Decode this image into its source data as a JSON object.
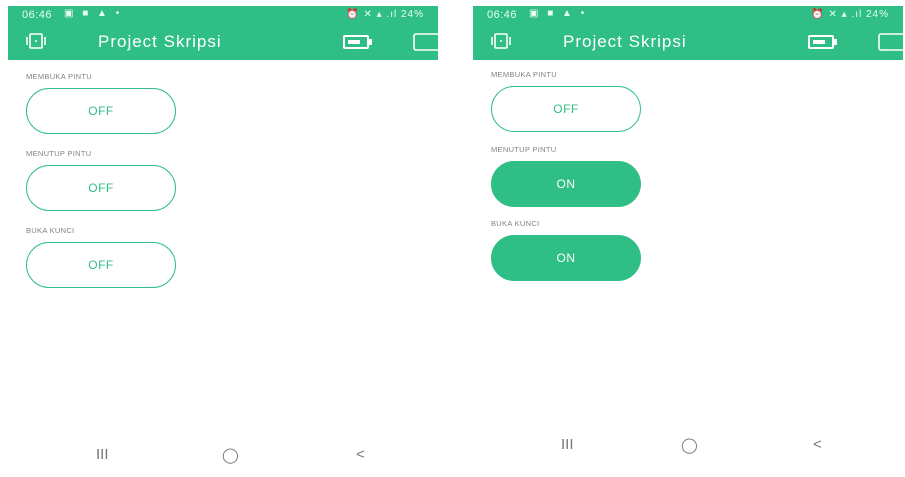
{
  "colors": {
    "accent": "#2fbe86",
    "label": "#7d8583",
    "background": "#ffffff"
  },
  "screens": [
    {
      "status_bar": {
        "time": "06:46",
        "battery": "24%",
        "icons": [
          "gallery-icon",
          "folder-icon",
          "alert-icon",
          "dot-icon",
          "alarm-icon",
          "mute-icon",
          "signal-icon"
        ]
      },
      "app_bar": {
        "title": "Project Skripsi"
      },
      "widgets": [
        {
          "label": "MEMBUKA PINTU",
          "state": "OFF"
        },
        {
          "label": "MENUTUP PINTU",
          "state": "OFF"
        },
        {
          "label": "BUKA KUNCI",
          "state": "OFF"
        }
      ],
      "nav": {
        "recents": "III",
        "home": "◯",
        "back": "<"
      }
    },
    {
      "status_bar": {
        "time": "06:46",
        "battery": "24%",
        "icons": [
          "gallery-icon",
          "folder-icon",
          "alert-icon",
          "dot-icon",
          "alarm-icon",
          "mute-icon",
          "signal-icon"
        ]
      },
      "app_bar": {
        "title": "Project Skripsi"
      },
      "widgets": [
        {
          "label": "MEMBUKA PINTU",
          "state": "OFF"
        },
        {
          "label": "MENUTUP PINTU",
          "state": "ON"
        },
        {
          "label": "BUKA KUNCI",
          "state": "ON"
        }
      ],
      "nav": {
        "recents": "III",
        "home": "◯",
        "back": "<"
      }
    }
  ]
}
